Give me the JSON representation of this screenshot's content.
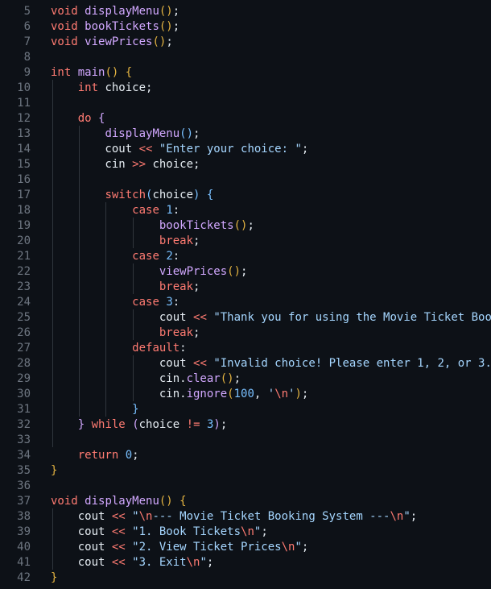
{
  "lines": [
    {
      "n": "5",
      "tokens": [
        [
          "kw",
          "void"
        ],
        [
          "id",
          " "
        ],
        [
          "fn",
          "displayMenu"
        ],
        [
          "p1",
          "()"
        ],
        [
          "id",
          ";"
        ]
      ]
    },
    {
      "n": "6",
      "tokens": [
        [
          "kw",
          "void"
        ],
        [
          "id",
          " "
        ],
        [
          "fn",
          "bookTickets"
        ],
        [
          "p1",
          "()"
        ],
        [
          "id",
          ";"
        ]
      ]
    },
    {
      "n": "7",
      "tokens": [
        [
          "kw",
          "void"
        ],
        [
          "id",
          " "
        ],
        [
          "fn",
          "viewPrices"
        ],
        [
          "p1",
          "()"
        ],
        [
          "id",
          ";"
        ]
      ]
    },
    {
      "n": "8",
      "tokens": []
    },
    {
      "n": "9",
      "tokens": [
        [
          "kw",
          "int"
        ],
        [
          "id",
          " "
        ],
        [
          "fn",
          "main"
        ],
        [
          "p1",
          "()"
        ],
        [
          "id",
          " "
        ],
        [
          "p1",
          "{"
        ]
      ]
    },
    {
      "n": "10",
      "tokens": [
        [
          "id",
          "    "
        ],
        [
          "kw",
          "int"
        ],
        [
          "id",
          " choice;"
        ]
      ]
    },
    {
      "n": "11",
      "tokens": []
    },
    {
      "n": "12",
      "tokens": [
        [
          "id",
          "    "
        ],
        [
          "kw",
          "do"
        ],
        [
          "id",
          " "
        ],
        [
          "p2",
          "{"
        ]
      ]
    },
    {
      "n": "13",
      "tokens": [
        [
          "id",
          "        "
        ],
        [
          "fn",
          "displayMenu"
        ],
        [
          "p3",
          "()"
        ],
        [
          "id",
          ";"
        ]
      ]
    },
    {
      "n": "14",
      "tokens": [
        [
          "id",
          "        cout "
        ],
        [
          "op",
          "<<"
        ],
        [
          "id",
          " "
        ],
        [
          "str",
          "\"Enter your choice: \""
        ],
        [
          "id",
          ";"
        ]
      ]
    },
    {
      "n": "15",
      "tokens": [
        [
          "id",
          "        cin "
        ],
        [
          "op",
          ">>"
        ],
        [
          "id",
          " choice;"
        ]
      ]
    },
    {
      "n": "16",
      "tokens": []
    },
    {
      "n": "17",
      "tokens": [
        [
          "id",
          "        "
        ],
        [
          "kw",
          "switch"
        ],
        [
          "p3",
          "("
        ],
        [
          "id",
          "choice"
        ],
        [
          "p3",
          ")"
        ],
        [
          "id",
          " "
        ],
        [
          "p3",
          "{"
        ]
      ]
    },
    {
      "n": "18",
      "tokens": [
        [
          "id",
          "            "
        ],
        [
          "kw",
          "case"
        ],
        [
          "id",
          " "
        ],
        [
          "num",
          "1"
        ],
        [
          "id",
          ":"
        ]
      ]
    },
    {
      "n": "19",
      "tokens": [
        [
          "id",
          "                "
        ],
        [
          "fn",
          "bookTickets"
        ],
        [
          "p1",
          "()"
        ],
        [
          "id",
          ";"
        ]
      ]
    },
    {
      "n": "20",
      "tokens": [
        [
          "id",
          "                "
        ],
        [
          "kw",
          "break"
        ],
        [
          "id",
          ";"
        ]
      ]
    },
    {
      "n": "21",
      "tokens": [
        [
          "id",
          "            "
        ],
        [
          "kw",
          "case"
        ],
        [
          "id",
          " "
        ],
        [
          "num",
          "2"
        ],
        [
          "id",
          ":"
        ]
      ]
    },
    {
      "n": "22",
      "tokens": [
        [
          "id",
          "                "
        ],
        [
          "fn",
          "viewPrices"
        ],
        [
          "p1",
          "()"
        ],
        [
          "id",
          ";"
        ]
      ]
    },
    {
      "n": "23",
      "tokens": [
        [
          "id",
          "                "
        ],
        [
          "kw",
          "break"
        ],
        [
          "id",
          ";"
        ]
      ]
    },
    {
      "n": "24",
      "tokens": [
        [
          "id",
          "            "
        ],
        [
          "kw",
          "case"
        ],
        [
          "id",
          " "
        ],
        [
          "num",
          "3"
        ],
        [
          "id",
          ":"
        ]
      ]
    },
    {
      "n": "25",
      "tokens": [
        [
          "id",
          "                cout "
        ],
        [
          "op",
          "<<"
        ],
        [
          "id",
          " "
        ],
        [
          "str",
          "\"Thank you for using the Movie Ticket Boo"
        ]
      ]
    },
    {
      "n": "26",
      "tokens": [
        [
          "id",
          "                "
        ],
        [
          "kw",
          "break"
        ],
        [
          "id",
          ";"
        ]
      ]
    },
    {
      "n": "27",
      "tokens": [
        [
          "id",
          "            "
        ],
        [
          "kw",
          "default"
        ],
        [
          "id",
          ":"
        ]
      ]
    },
    {
      "n": "28",
      "tokens": [
        [
          "id",
          "                cout "
        ],
        [
          "op",
          "<<"
        ],
        [
          "id",
          " "
        ],
        [
          "str",
          "\"Invalid choice! Please enter 1, 2, or 3."
        ]
      ]
    },
    {
      "n": "29",
      "tokens": [
        [
          "id",
          "                cin."
        ],
        [
          "fn",
          "clear"
        ],
        [
          "p1",
          "()"
        ],
        [
          "id",
          ";"
        ]
      ]
    },
    {
      "n": "30",
      "tokens": [
        [
          "id",
          "                cin."
        ],
        [
          "fn",
          "ignore"
        ],
        [
          "p1",
          "("
        ],
        [
          "num",
          "100"
        ],
        [
          "id",
          ", "
        ],
        [
          "str",
          "'"
        ],
        [
          "esc",
          "\\n"
        ],
        [
          "str",
          "'"
        ],
        [
          "p1",
          ")"
        ],
        [
          "id",
          ";"
        ]
      ]
    },
    {
      "n": "31",
      "tokens": [
        [
          "id",
          "            "
        ],
        [
          "p3",
          "}"
        ]
      ]
    },
    {
      "n": "32",
      "tokens": [
        [
          "id",
          "    "
        ],
        [
          "p2",
          "}"
        ],
        [
          "id",
          " "
        ],
        [
          "kw",
          "while"
        ],
        [
          "id",
          " "
        ],
        [
          "p2",
          "("
        ],
        [
          "id",
          "choice "
        ],
        [
          "op",
          "!="
        ],
        [
          "id",
          " "
        ],
        [
          "num",
          "3"
        ],
        [
          "p2",
          ")"
        ],
        [
          "id",
          ";"
        ]
      ]
    },
    {
      "n": "33",
      "tokens": []
    },
    {
      "n": "34",
      "tokens": [
        [
          "id",
          "    "
        ],
        [
          "kw",
          "return"
        ],
        [
          "id",
          " "
        ],
        [
          "num",
          "0"
        ],
        [
          "id",
          ";"
        ]
      ]
    },
    {
      "n": "35",
      "tokens": [
        [
          "p1",
          "}"
        ]
      ]
    },
    {
      "n": "36",
      "tokens": []
    },
    {
      "n": "37",
      "tokens": [
        [
          "kw",
          "void"
        ],
        [
          "id",
          " "
        ],
        [
          "fn",
          "displayMenu"
        ],
        [
          "p1",
          "()"
        ],
        [
          "id",
          " "
        ],
        [
          "p1",
          "{"
        ]
      ]
    },
    {
      "n": "38",
      "tokens": [
        [
          "id",
          "    cout "
        ],
        [
          "op",
          "<<"
        ],
        [
          "id",
          " "
        ],
        [
          "str",
          "\""
        ],
        [
          "esc",
          "\\n"
        ],
        [
          "str",
          "--- Movie Ticket Booking System ---"
        ],
        [
          "esc",
          "\\n"
        ],
        [
          "str",
          "\""
        ],
        [
          "id",
          ";"
        ]
      ]
    },
    {
      "n": "39",
      "tokens": [
        [
          "id",
          "    cout "
        ],
        [
          "op",
          "<<"
        ],
        [
          "id",
          " "
        ],
        [
          "str",
          "\"1. Book Tickets"
        ],
        [
          "esc",
          "\\n"
        ],
        [
          "str",
          "\""
        ],
        [
          "id",
          ";"
        ]
      ]
    },
    {
      "n": "40",
      "tokens": [
        [
          "id",
          "    cout "
        ],
        [
          "op",
          "<<"
        ],
        [
          "id",
          " "
        ],
        [
          "str",
          "\"2. View Ticket Prices"
        ],
        [
          "esc",
          "\\n"
        ],
        [
          "str",
          "\""
        ],
        [
          "id",
          ";"
        ]
      ]
    },
    {
      "n": "41",
      "tokens": [
        [
          "id",
          "    cout "
        ],
        [
          "op",
          "<<"
        ],
        [
          "id",
          " "
        ],
        [
          "str",
          "\"3. Exit"
        ],
        [
          "esc",
          "\\n"
        ],
        [
          "str",
          "\""
        ],
        [
          "id",
          ";"
        ]
      ]
    },
    {
      "n": "42",
      "tokens": [
        [
          "p1",
          "}"
        ]
      ]
    }
  ],
  "colors": {
    "background": "#0d1117",
    "line_number": "#6e7681",
    "keyword": "#ff7b72",
    "function": "#d2a8ff",
    "string": "#a5d6ff",
    "number": "#79c0ff"
  }
}
